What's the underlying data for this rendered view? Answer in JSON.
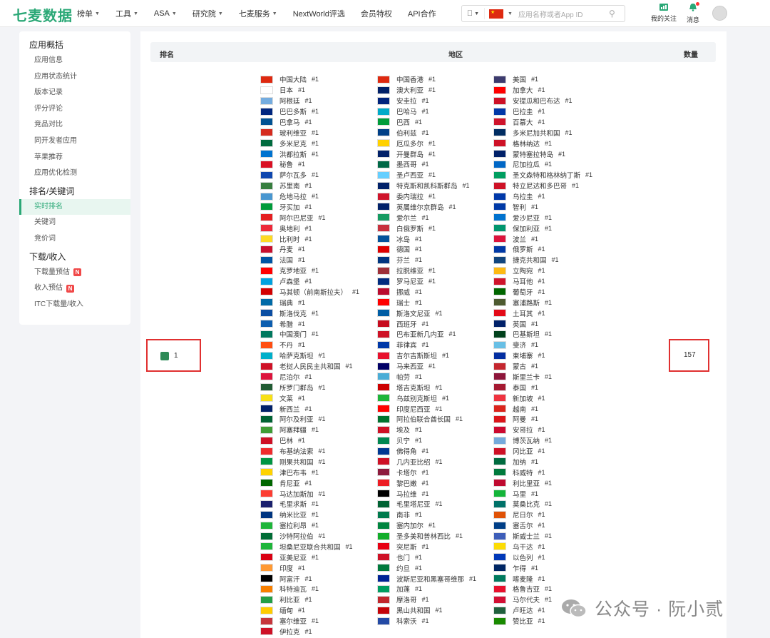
{
  "app": {
    "logo": "七麦数据"
  },
  "nav": [
    {
      "label": "榜单",
      "caret": true
    },
    {
      "label": "工具",
      "caret": true
    },
    {
      "label": "ASA",
      "caret": true
    },
    {
      "label": "研究院",
      "caret": true
    },
    {
      "label": "七麦服务",
      "caret": true
    },
    {
      "label": "NextWorld评选",
      "caret": false
    },
    {
      "label": "会员特权",
      "caret": false
    },
    {
      "label": "API合作",
      "caret": false
    }
  ],
  "search": {
    "placeholder": "应用名称或者App ID",
    "region": "中国"
  },
  "top_right": {
    "my_follow": "我的关注",
    "messages": "消息"
  },
  "sidebar": {
    "groups": [
      {
        "title": "应用概括",
        "items": [
          {
            "label": "应用信息"
          },
          {
            "label": "应用状态统计"
          },
          {
            "label": "版本记录"
          },
          {
            "label": "评分评论"
          },
          {
            "label": "竞品对比"
          },
          {
            "label": "同开发者应用"
          },
          {
            "label": "苹果推荐"
          },
          {
            "label": "应用优化检测"
          }
        ]
      },
      {
        "title": "排名/关键词",
        "items": [
          {
            "label": "实时排名",
            "active": true
          },
          {
            "label": "关键词"
          },
          {
            "label": "竞价词"
          }
        ]
      },
      {
        "title": "下载/收入",
        "items": [
          {
            "label": "下载量预估",
            "badge": "N"
          },
          {
            "label": "收入预估",
            "badge": "N"
          },
          {
            "label": "ITC下载量/收入"
          }
        ]
      }
    ]
  },
  "table": {
    "headers": {
      "rank": "排名",
      "region": "地区",
      "count": "数量"
    },
    "rank": "1",
    "count": "157",
    "rank_mark": "#1",
    "columns": [
      [
        "中国大陆",
        "日本",
        "阿根廷",
        "巴巴多斯",
        "巴拿马",
        "玻利维亚",
        "多米尼克",
        "洪都拉斯",
        "秘鲁",
        "萨尔瓦多",
        "苏里南",
        "危地马拉",
        "牙买加",
        "阿尔巴尼亚",
        "奥地利",
        "比利时",
        "丹麦",
        "法国",
        "克罗地亚",
        "卢森堡",
        "马其顿（前南斯拉夫）",
        "瑞典",
        "斯洛伐克",
        "希腊",
        "中国澳门",
        "不丹",
        "哈萨克斯坦",
        "老挝人民民主共和国",
        "尼泊尔",
        "所罗门群岛",
        "文莱",
        "新西兰",
        "阿尔及利亚",
        "阿塞拜疆",
        "巴林",
        "布基纳法索",
        "刚果共和国",
        "津巴布韦",
        "肯尼亚",
        "马达加斯加",
        "毛里求斯",
        "纳米比亚",
        "塞拉利昂",
        "沙特阿拉伯",
        "坦桑尼亚联合共和国",
        "亚美尼亚",
        "印度",
        "阿富汗",
        "科特迪瓦",
        "利比亚",
        "缅甸",
        "塞尔维亚",
        "伊拉克"
      ],
      [
        "中国香港",
        "澳大利亚",
        "安圭拉",
        "巴哈马",
        "巴西",
        "伯利兹",
        "厄瓜多尔",
        "开曼群岛",
        "墨西哥",
        "圣卢西亚",
        "特克斯和凯科斯群岛",
        "委内瑞拉",
        "英属维尔京群岛",
        "爱尔兰",
        "白俄罗斯",
        "冰岛",
        "德国",
        "芬兰",
        "拉脱维亚",
        "罗马尼亚",
        "挪威",
        "瑞士",
        "斯洛文尼亚",
        "西班牙",
        "巴布亚新几内亚",
        "菲律宾",
        "吉尔吉斯斯坦",
        "马来西亚",
        "帕劳",
        "塔吉克斯坦",
        "乌兹别克斯坦",
        "印度尼西亚",
        "阿拉伯联合酋长国",
        "埃及",
        "贝宁",
        "佛得角",
        "几内亚比绍",
        "卡塔尔",
        "黎巴嫩",
        "马拉维",
        "毛里塔尼亚",
        "南非",
        "塞内加尔",
        "圣多美和普林西比",
        "突尼斯",
        "也门",
        "约旦",
        "波斯尼亚和黑塞哥维那",
        "加蓬",
        "摩洛哥",
        "黑山共和国",
        "科索沃"
      ],
      [
        "美国",
        "加拿大",
        "安提瓜和巴布达",
        "巴拉圭",
        "百慕大",
        "多米尼加共和国",
        "格林纳达",
        "蒙特塞拉特岛",
        "尼加拉瓜",
        "圣文森特和格林纳丁斯",
        "特立尼达和多巴哥",
        "乌拉圭",
        "智利",
        "爱沙尼亚",
        "保加利亚",
        "波兰",
        "俄罗斯",
        "捷克共和国",
        "立陶宛",
        "马耳他",
        "葡萄牙",
        "塞浦路斯",
        "土耳其",
        "英国",
        "巴基斯坦",
        "斐济",
        "柬埔寨",
        "蒙古",
        "斯里兰卡",
        "泰国",
        "新加坡",
        "越南",
        "阿曼",
        "安哥拉",
        "博茨瓦纳",
        "冈比亚",
        "加纳",
        "科威特",
        "利比里亚",
        "马里",
        "莫桑比克",
        "尼日尔",
        "塞舌尔",
        "斯威士兰",
        "乌干达",
        "以色列",
        "乍得",
        "喀麦隆",
        "格鲁吉亚",
        "马尔代夫",
        "卢旺达",
        "赞比亚"
      ]
    ],
    "flag_colors": [
      [
        "#de2910",
        "#ffffff",
        "#74acdf",
        "#00267f",
        "#005293",
        "#d52b1e",
        "#006b3f",
        "#0073cf",
        "#d91023",
        "#0f47af",
        "#377e3f",
        "#4997d0",
        "#009b3a",
        "#e41e20",
        "#ed2939",
        "#fdda24",
        "#c8102e",
        "#0055a4",
        "#ff0000",
        "#00a1de",
        "#d20000",
        "#006aa7",
        "#0b4ea2",
        "#0d5eaf",
        "#00785e",
        "#ff4e12",
        "#00afca",
        "#ce1126",
        "#dc143c",
        "#215b33",
        "#f7e017",
        "#012169",
        "#006233",
        "#3f9c35",
        "#ce1126",
        "#ef2b2d",
        "#009543",
        "#ffd200",
        "#006600",
        "#fc3d32",
        "#1a206d",
        "#003580",
        "#1eb53a",
        "#006c35",
        "#1eb53a",
        "#d90012",
        "#ff9933",
        "#000000",
        "#f77f00",
        "#239e46",
        "#fecb00",
        "#c6363c",
        "#ce1126"
      ],
      [
        "#de2910",
        "#012169",
        "#00247d",
        "#00abc9",
        "#009c3b",
        "#003f87",
        "#ffd100",
        "#012169",
        "#006847",
        "#65cfff",
        "#012169",
        "#cf142b",
        "#012169",
        "#169b62",
        "#c8313e",
        "#02529c",
        "#dd0000",
        "#003580",
        "#9e3039",
        "#002b7f",
        "#ba0c2f",
        "#ff0000",
        "#005da4",
        "#c60b1e",
        "#ce1126",
        "#0038a8",
        "#e8112d",
        "#010066",
        "#4aadd6",
        "#cc0000",
        "#1eb53a",
        "#ff0000",
        "#00732f",
        "#ce1126",
        "#008751",
        "#003893",
        "#ce1126",
        "#8d1b3d",
        "#ed1c24",
        "#000000",
        "#006233",
        "#007a4d",
        "#00853f",
        "#12ad2b",
        "#e70013",
        "#ce1126",
        "#007a3d",
        "#002395",
        "#009e60",
        "#c1272d",
        "#c40308",
        "#244aa5"
      ],
      [
        "#3c3b6e",
        "#ff0000",
        "#ce1126",
        "#0038a8",
        "#cf142b",
        "#002d62",
        "#ce1126",
        "#012169",
        "#0067c6",
        "#009e60",
        "#ce1126",
        "#0038a8",
        "#0039a6",
        "#0072ce",
        "#00966e",
        "#dc143c",
        "#0039a6",
        "#11457e",
        "#fdb913",
        "#cf142b",
        "#006600",
        "#4e5b31",
        "#e30a17",
        "#012169",
        "#01411c",
        "#68bfe5",
        "#032ea1",
        "#c4272f",
        "#8d153a",
        "#a51931",
        "#ef3340",
        "#da251d",
        "#db161b",
        "#cc092f",
        "#75aadb",
        "#ce1126",
        "#006b3f",
        "#007a3d",
        "#bf0a30",
        "#14b53a",
        "#007168",
        "#e05206",
        "#003f87",
        "#3e5eb9",
        "#fcdc04",
        "#0038b8",
        "#002664",
        "#007a5e",
        "#e8112d",
        "#d21034",
        "#20603d",
        "#198a00"
      ]
    ]
  },
  "watermark": {
    "text": "公众号 · 阮小贰"
  }
}
